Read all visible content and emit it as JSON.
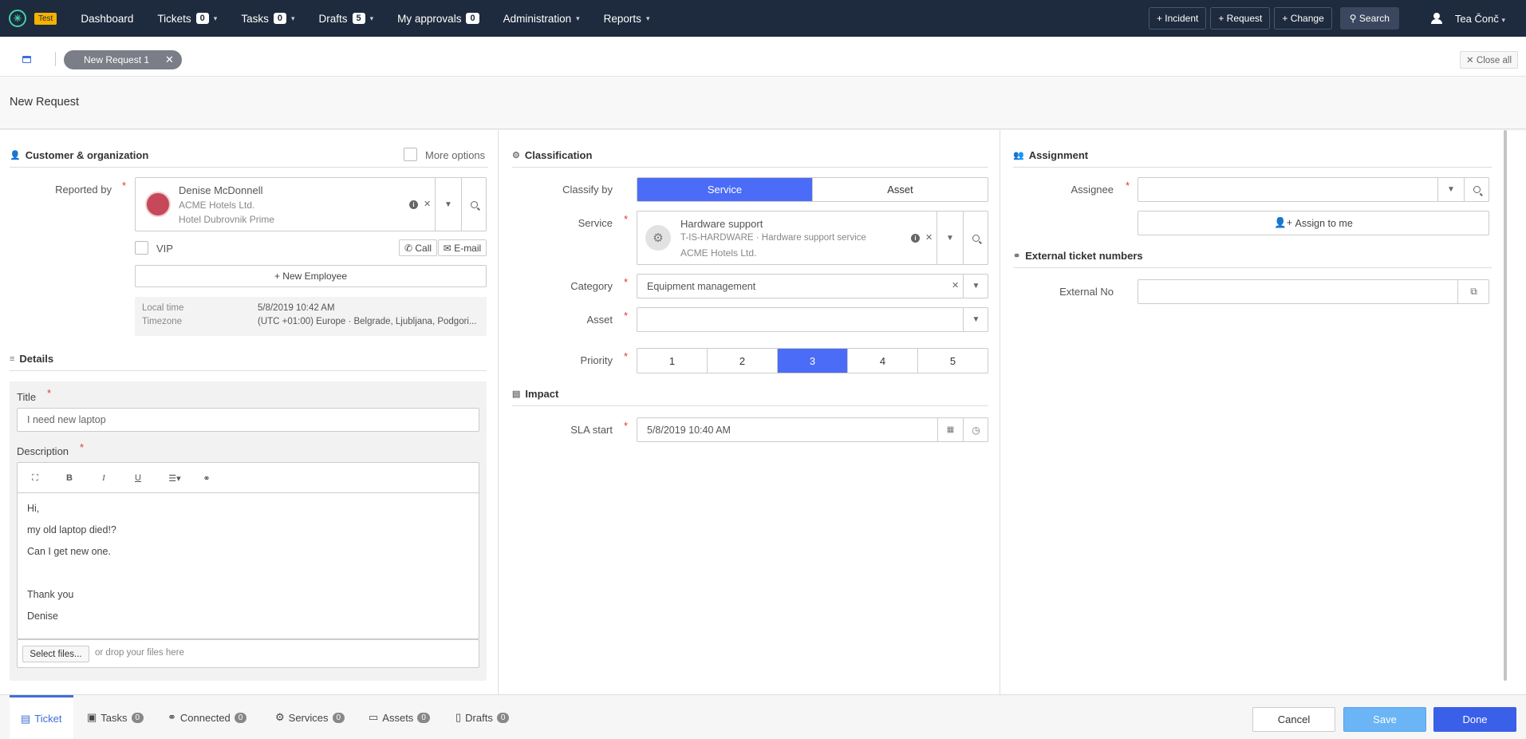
{
  "nav": {
    "env_badge": "Test",
    "dashboard": "Dashboard",
    "tickets": "Tickets",
    "tickets_count": "0",
    "tasks": "Tasks",
    "tasks_count": "0",
    "drafts": "Drafts",
    "drafts_count": "5",
    "approvals": "My approvals",
    "approvals_count": "0",
    "administration": "Administration",
    "reports": "Reports",
    "incident": "+ Incident",
    "request": "+ Request",
    "change": "+ Change",
    "search": "Search",
    "user": "Tea Čonč"
  },
  "tabs": {
    "open_tab": "New Request 1",
    "close_all": "Close all"
  },
  "page_title": "New Request",
  "customer": {
    "header": "Customer & organization",
    "more_options": "More options",
    "reported_by_label": "Reported by",
    "name": "Denise McDonnell",
    "org": "ACME Hotels Ltd.",
    "location": "Hotel Dubrovnik Prime",
    "vip": "VIP",
    "call": "Call",
    "email": "E-mail",
    "new_employee": "+ New Employee",
    "local_time_label": "Local time",
    "local_time": "5/8/2019 10:42 AM",
    "timezone_label": "Timezone",
    "timezone": "(UTC +01:00) Europe · Belgrade, Ljubljana, Podgori..."
  },
  "details": {
    "header": "Details",
    "title_label": "Title",
    "title_value": "I need new laptop",
    "description_label": "Description",
    "description_lines": [
      "Hi,",
      "my old laptop died!?",
      "Can I get new one.",
      "",
      "Thank you",
      "Denise"
    ],
    "select_files": "Select files...",
    "drop_text": "or drop your files here"
  },
  "classification": {
    "header": "Classification",
    "classify_by_label": "Classify by",
    "classify_options": [
      "Service",
      "Asset"
    ],
    "classify_selected": "Service",
    "service_label": "Service",
    "service_name": "Hardware support",
    "service_code": "T-IS-HARDWARE · Hardware support service",
    "service_org": "ACME Hotels Ltd.",
    "category_label": "Category",
    "category_value": "Equipment management",
    "asset_label": "Asset",
    "priority_label": "Priority",
    "priority_options": [
      "1",
      "2",
      "3",
      "4",
      "5"
    ],
    "priority_selected": "3"
  },
  "impact": {
    "header": "Impact",
    "sla_label": "SLA start",
    "sla_value": "5/8/2019 10:40 AM"
  },
  "assignment": {
    "header": "Assignment",
    "assignee_label": "Assignee",
    "assign_to_me": "Assign to me",
    "external_header": "External ticket numbers",
    "external_label": "External No"
  },
  "bottom": {
    "tabs": [
      {
        "label": "Ticket"
      },
      {
        "label": "Tasks",
        "count": "0"
      },
      {
        "label": "Connected",
        "count": "0"
      },
      {
        "label": "Services",
        "count": "0"
      },
      {
        "label": "Assets",
        "count": "0"
      },
      {
        "label": "Drafts",
        "count": "0"
      }
    ],
    "cancel": "Cancel",
    "save": "Save",
    "done": "Done"
  },
  "colors": {
    "nav_bg": "#1e2a3d",
    "accent": "#4a6cf7",
    "save_bg": "#6bb4f5",
    "required": "#d9383a"
  }
}
